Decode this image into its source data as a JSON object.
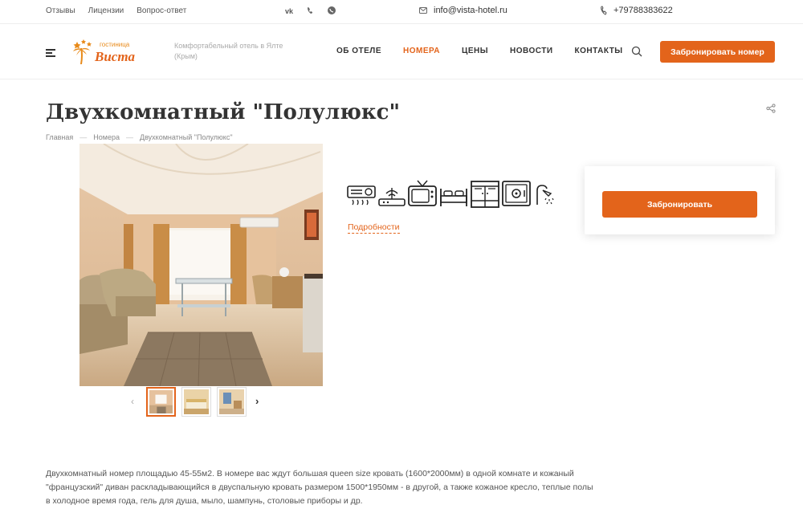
{
  "topbar": {
    "links": [
      "Отзывы",
      "Лицензии",
      "Вопрос-ответ"
    ],
    "social_icons": [
      "vk-icon",
      "viber-icon",
      "whatsapp-icon"
    ],
    "email": "info@vista-hotel.ru",
    "phone": "+79788383622"
  },
  "header": {
    "logo_top": "гостиница",
    "logo_name": "Виста",
    "tagline": "Комфортабельный отель в Ялте (Крым)",
    "nav": [
      "ОБ ОТЕЛЕ",
      "НОМЕРА",
      "ЦЕНЫ",
      "НОВОСТИ",
      "КОНТАКТЫ"
    ],
    "nav_active": "НОМЕРА",
    "book_label": "Забронировать номер"
  },
  "page": {
    "title": "Двухкомнатный \"Полулюкс\"",
    "breadcrumb": [
      "Главная",
      "Номера",
      "Двухкомнатный \"Полулюкс\""
    ]
  },
  "gallery": {
    "thumbs_count": 3,
    "active_index": 0
  },
  "amenities": [
    "air-conditioner-icon",
    "wifi-router-icon",
    "tv-icon",
    "bed-icon",
    "wardrobe-icon",
    "safe-icon",
    "shower-icon"
  ],
  "details_link": "Подробности",
  "booking": {
    "button_label": "Забронировать"
  },
  "description": "Двухкомнатный номер площадью 45-55м2. В номере вас ждут большая queen size кровать (1600*2000мм) в одной комнате и кожаный \"французский\" диван раскладывающийся в двуспальную кровать размером 1500*1950мм - в другой, а также кожаное кресло, теплые полы в холодное время года, гель для душа, мыло, шампунь, столовые приборы и др.",
  "colors": {
    "accent": "#e3641b",
    "text": "#333333"
  }
}
